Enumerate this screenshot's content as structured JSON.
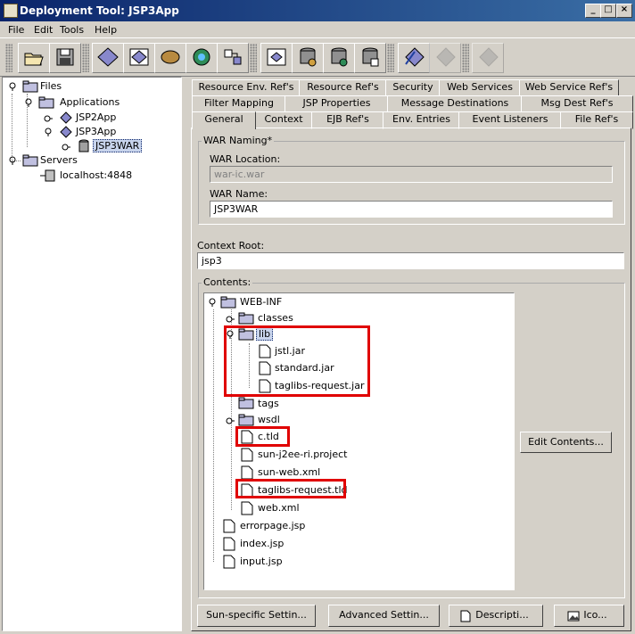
{
  "window": {
    "title": "Deployment Tool: JSP3App"
  },
  "menu": {
    "file": "File",
    "edit": "Edit",
    "tools": "Tools",
    "help": "Help"
  },
  "toolbar": {
    "buttons": [
      "open-icon",
      "save-icon",
      "new-application-icon",
      "new-web-component-icon",
      "new-bean-icon",
      "new-app-client-icon",
      "new-connector-icon",
      "add-file-icon",
      "deploy-icon",
      "server-icon",
      "database-icon",
      "security-icon",
      "verify-icon",
      "undeploy-icon",
      "disabled-icon"
    ]
  },
  "tree": {
    "files": "Files",
    "applications": "Applications",
    "jsp2app": "JSP2App",
    "jsp3app": "JSP3App",
    "jsp3war": "JSP3WAR",
    "servers": "Servers",
    "localhost": "localhost:4848"
  },
  "tabs": {
    "row1": [
      "Resource Env. Ref's",
      "Resource Ref's",
      "Security",
      "Web Services",
      "Web Service Ref's"
    ],
    "row2": [
      "Filter Mapping",
      "JSP Properties",
      "Message Destinations",
      "Msg Dest Ref's"
    ],
    "row3": [
      "General",
      "Context",
      "EJB Ref's",
      "Env. Entries",
      "Event Listeners",
      "File Ref's"
    ]
  },
  "general": {
    "war_naming_title": "WAR Naming*",
    "war_location_label": "WAR Location:",
    "war_location_value": "war-ic.war",
    "war_name_label": "WAR Name:",
    "war_name_value": "JSP3WAR",
    "context_root_label": "Context Root:",
    "context_root_value": "jsp3",
    "contents_title": "Contents:",
    "edit_contents": "Edit Contents..."
  },
  "contents": {
    "webinf": "WEB-INF",
    "classes": "classes",
    "lib": "lib",
    "jstl": "jstl.jar",
    "standard": "standard.jar",
    "taglibs_request_jar": "taglibs-request.jar",
    "tags": "tags",
    "wsdl": "wsdl",
    "ctld": "c.tld",
    "sunproject": "sun-j2ee-ri.project",
    "sunweb": "sun-web.xml",
    "taglibs_request_tld": "taglibs-request.tld",
    "webxml": "web.xml",
    "errorpage": "errorpage.jsp",
    "index": "index.jsp",
    "input": "input.jsp"
  },
  "bottom_buttons": {
    "sun_specific": "Sun-specific Settin...",
    "advanced": "Advanced Settin...",
    "description": "Descripti...",
    "icons": "Ico..."
  }
}
